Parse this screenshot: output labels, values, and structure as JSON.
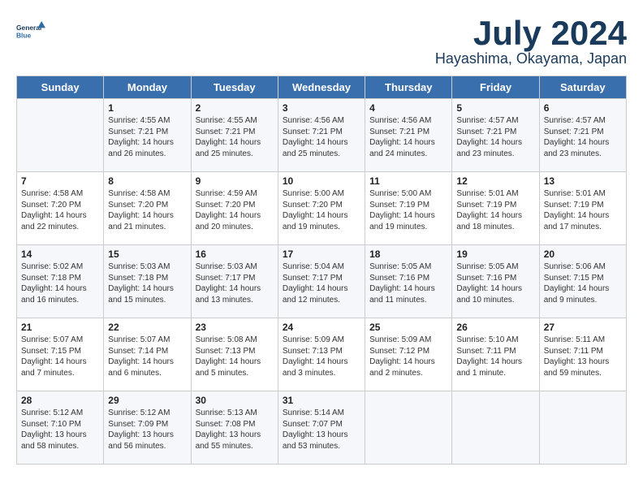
{
  "header": {
    "logo_line1": "General",
    "logo_line2": "Blue",
    "month": "July 2024",
    "location": "Hayashima, Okayama, Japan"
  },
  "days_of_week": [
    "Sunday",
    "Monday",
    "Tuesday",
    "Wednesday",
    "Thursday",
    "Friday",
    "Saturday"
  ],
  "weeks": [
    [
      {
        "day": "",
        "content": ""
      },
      {
        "day": "1",
        "content": "Sunrise: 4:55 AM\nSunset: 7:21 PM\nDaylight: 14 hours\nand 26 minutes."
      },
      {
        "day": "2",
        "content": "Sunrise: 4:55 AM\nSunset: 7:21 PM\nDaylight: 14 hours\nand 25 minutes."
      },
      {
        "day": "3",
        "content": "Sunrise: 4:56 AM\nSunset: 7:21 PM\nDaylight: 14 hours\nand 25 minutes."
      },
      {
        "day": "4",
        "content": "Sunrise: 4:56 AM\nSunset: 7:21 PM\nDaylight: 14 hours\nand 24 minutes."
      },
      {
        "day": "5",
        "content": "Sunrise: 4:57 AM\nSunset: 7:21 PM\nDaylight: 14 hours\nand 23 minutes."
      },
      {
        "day": "6",
        "content": "Sunrise: 4:57 AM\nSunset: 7:21 PM\nDaylight: 14 hours\nand 23 minutes."
      }
    ],
    [
      {
        "day": "7",
        "content": "Sunrise: 4:58 AM\nSunset: 7:20 PM\nDaylight: 14 hours\nand 22 minutes."
      },
      {
        "day": "8",
        "content": "Sunrise: 4:58 AM\nSunset: 7:20 PM\nDaylight: 14 hours\nand 21 minutes."
      },
      {
        "day": "9",
        "content": "Sunrise: 4:59 AM\nSunset: 7:20 PM\nDaylight: 14 hours\nand 20 minutes."
      },
      {
        "day": "10",
        "content": "Sunrise: 5:00 AM\nSunset: 7:20 PM\nDaylight: 14 hours\nand 19 minutes."
      },
      {
        "day": "11",
        "content": "Sunrise: 5:00 AM\nSunset: 7:19 PM\nDaylight: 14 hours\nand 19 minutes."
      },
      {
        "day": "12",
        "content": "Sunrise: 5:01 AM\nSunset: 7:19 PM\nDaylight: 14 hours\nand 18 minutes."
      },
      {
        "day": "13",
        "content": "Sunrise: 5:01 AM\nSunset: 7:19 PM\nDaylight: 14 hours\nand 17 minutes."
      }
    ],
    [
      {
        "day": "14",
        "content": "Sunrise: 5:02 AM\nSunset: 7:18 PM\nDaylight: 14 hours\nand 16 minutes."
      },
      {
        "day": "15",
        "content": "Sunrise: 5:03 AM\nSunset: 7:18 PM\nDaylight: 14 hours\nand 15 minutes."
      },
      {
        "day": "16",
        "content": "Sunrise: 5:03 AM\nSunset: 7:17 PM\nDaylight: 14 hours\nand 13 minutes."
      },
      {
        "day": "17",
        "content": "Sunrise: 5:04 AM\nSunset: 7:17 PM\nDaylight: 14 hours\nand 12 minutes."
      },
      {
        "day": "18",
        "content": "Sunrise: 5:05 AM\nSunset: 7:16 PM\nDaylight: 14 hours\nand 11 minutes."
      },
      {
        "day": "19",
        "content": "Sunrise: 5:05 AM\nSunset: 7:16 PM\nDaylight: 14 hours\nand 10 minutes."
      },
      {
        "day": "20",
        "content": "Sunrise: 5:06 AM\nSunset: 7:15 PM\nDaylight: 14 hours\nand 9 minutes."
      }
    ],
    [
      {
        "day": "21",
        "content": "Sunrise: 5:07 AM\nSunset: 7:15 PM\nDaylight: 14 hours\nand 7 minutes."
      },
      {
        "day": "22",
        "content": "Sunrise: 5:07 AM\nSunset: 7:14 PM\nDaylight: 14 hours\nand 6 minutes."
      },
      {
        "day": "23",
        "content": "Sunrise: 5:08 AM\nSunset: 7:13 PM\nDaylight: 14 hours\nand 5 minutes."
      },
      {
        "day": "24",
        "content": "Sunrise: 5:09 AM\nSunset: 7:13 PM\nDaylight: 14 hours\nand 3 minutes."
      },
      {
        "day": "25",
        "content": "Sunrise: 5:09 AM\nSunset: 7:12 PM\nDaylight: 14 hours\nand 2 minutes."
      },
      {
        "day": "26",
        "content": "Sunrise: 5:10 AM\nSunset: 7:11 PM\nDaylight: 14 hours\nand 1 minute."
      },
      {
        "day": "27",
        "content": "Sunrise: 5:11 AM\nSunset: 7:11 PM\nDaylight: 13 hours\nand 59 minutes."
      }
    ],
    [
      {
        "day": "28",
        "content": "Sunrise: 5:12 AM\nSunset: 7:10 PM\nDaylight: 13 hours\nand 58 minutes."
      },
      {
        "day": "29",
        "content": "Sunrise: 5:12 AM\nSunset: 7:09 PM\nDaylight: 13 hours\nand 56 minutes."
      },
      {
        "day": "30",
        "content": "Sunrise: 5:13 AM\nSunset: 7:08 PM\nDaylight: 13 hours\nand 55 minutes."
      },
      {
        "day": "31",
        "content": "Sunrise: 5:14 AM\nSunset: 7:07 PM\nDaylight: 13 hours\nand 53 minutes."
      },
      {
        "day": "",
        "content": ""
      },
      {
        "day": "",
        "content": ""
      },
      {
        "day": "",
        "content": ""
      }
    ]
  ]
}
